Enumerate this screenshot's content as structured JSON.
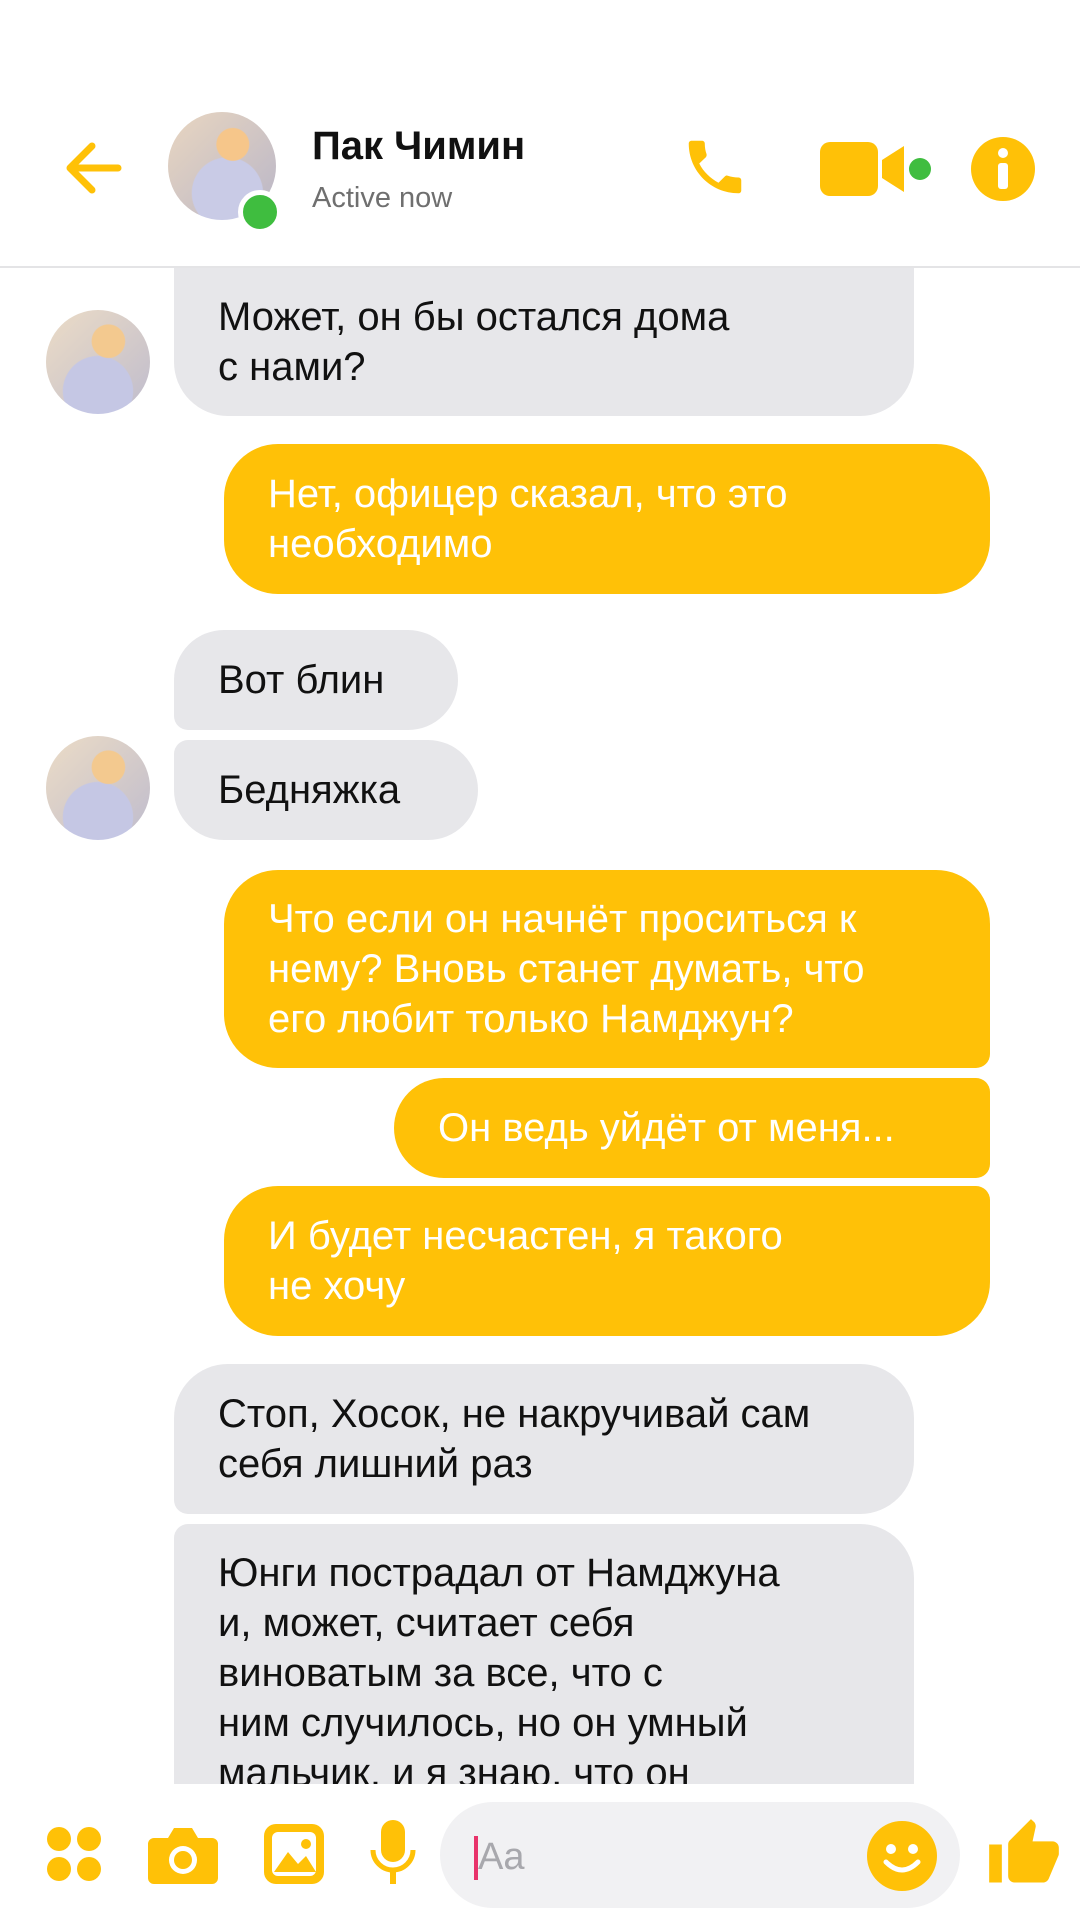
{
  "header": {
    "name": "Пак Чимин",
    "status": "Active now"
  },
  "messages": [
    {
      "side": "in",
      "lines": [
        "Может, он бы остался дома",
        "с нами?"
      ]
    },
    {
      "side": "out",
      "lines": [
        "Нет, офицер сказал, что это",
        "необходимо"
      ]
    },
    {
      "side": "in",
      "lines": [
        "Вот блин"
      ]
    },
    {
      "side": "in",
      "lines": [
        "Бедняжка"
      ]
    },
    {
      "side": "out",
      "lines": [
        "Что если он начнёт проситься к",
        "нему? Вновь станет думать, что",
        "его любит только Намджун?"
      ]
    },
    {
      "side": "out",
      "lines": [
        "Он ведь уйдёт от меня..."
      ]
    },
    {
      "side": "out",
      "lines": [
        "И будет несчастен, я такого",
        "не хочу"
      ]
    },
    {
      "side": "in",
      "lines": [
        "Стоп, Хосок, не накручивай сам",
        "себя лишний раз"
      ]
    },
    {
      "side": "in",
      "lines": [
        "Юнги пострадал от Намджуна",
        "и, может, считает себя",
        "виноватым за все, что с",
        "ним случилось, но он умный",
        "мальчик, и я знаю, что он"
      ]
    }
  ],
  "composer": {
    "placeholder": "Aa"
  },
  "colors": {
    "accent": "#ffc107",
    "incoming": "#e7e7ea",
    "online": "#3fbd3f"
  },
  "icons": [
    "back-arrow-icon",
    "phone-icon",
    "video-call-icon",
    "info-icon",
    "apps-grid-icon",
    "camera-icon",
    "gallery-icon",
    "microphone-icon",
    "emoji-icon",
    "thumbs-up-icon"
  ]
}
